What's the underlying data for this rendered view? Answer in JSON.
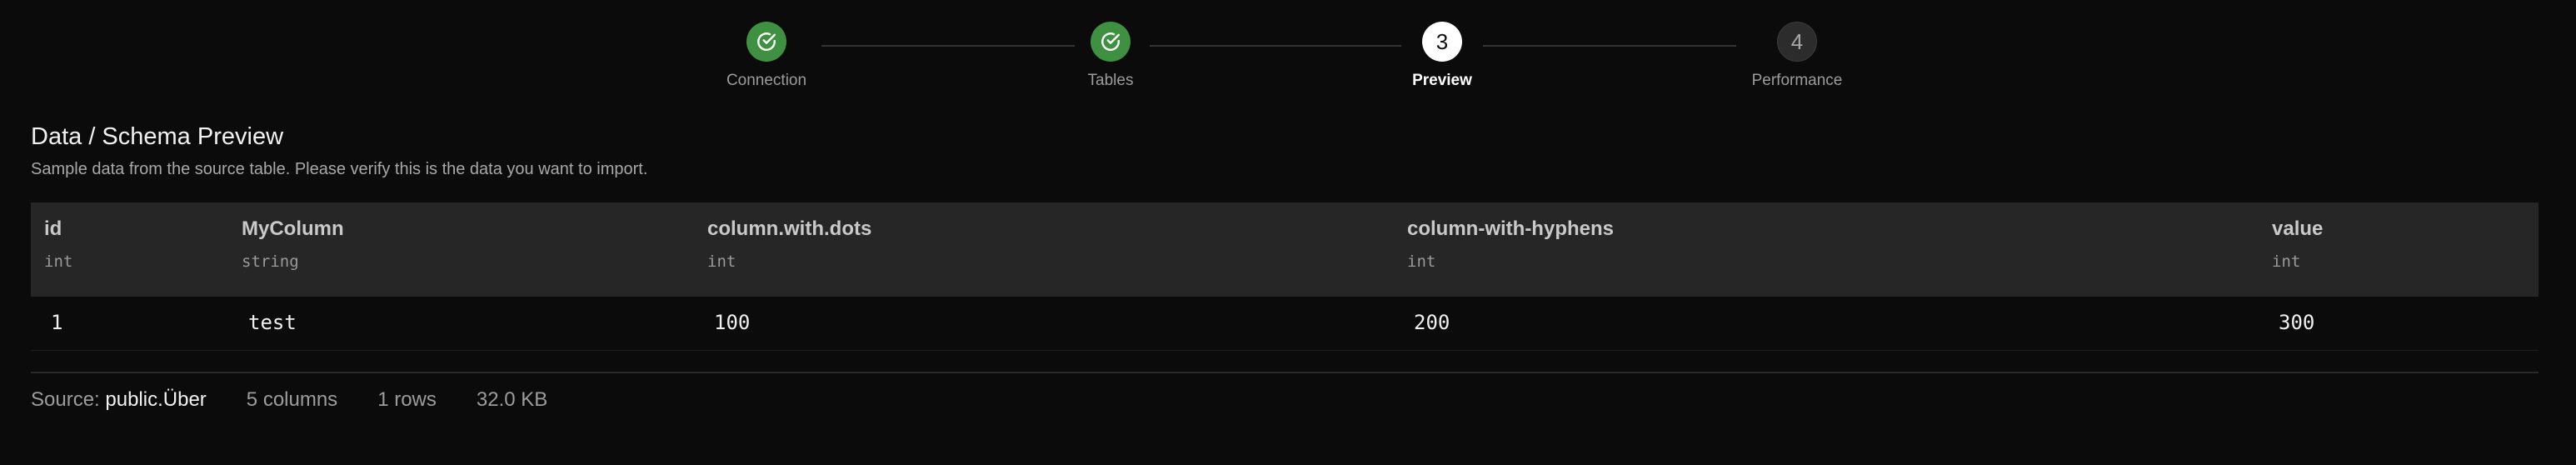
{
  "stepper": {
    "steps": [
      {
        "label": "Connection",
        "state": "done",
        "icon": "check-circle-icon"
      },
      {
        "label": "Tables",
        "state": "done",
        "icon": "check-circle-icon"
      },
      {
        "label": "Preview",
        "state": "active",
        "number": "3"
      },
      {
        "label": "Performance",
        "state": "pending",
        "number": "4"
      }
    ]
  },
  "heading": {
    "title": "Data / Schema Preview",
    "subtitle": "Sample data from the source table. Please verify this is the data you want to import."
  },
  "table": {
    "columns": [
      {
        "name": "id",
        "type": "int"
      },
      {
        "name": "MyColumn",
        "type": "string"
      },
      {
        "name": "column.with.dots",
        "type": "int"
      },
      {
        "name": "column-with-hyphens",
        "type": "int"
      },
      {
        "name": "value",
        "type": "int"
      }
    ],
    "rows": [
      [
        "1",
        "test",
        "100",
        "200",
        "300"
      ]
    ]
  },
  "footer": {
    "source_label": "Source:",
    "source_value": "public.Über",
    "columns_count": "5 columns",
    "rows_count": "1 rows",
    "size": "32.0 KB"
  },
  "colors": {
    "done": "#3f9142",
    "active": "#ffffff",
    "pending": "#2c2c2c",
    "background": "#0b0b0b",
    "header_row": "#262626"
  }
}
